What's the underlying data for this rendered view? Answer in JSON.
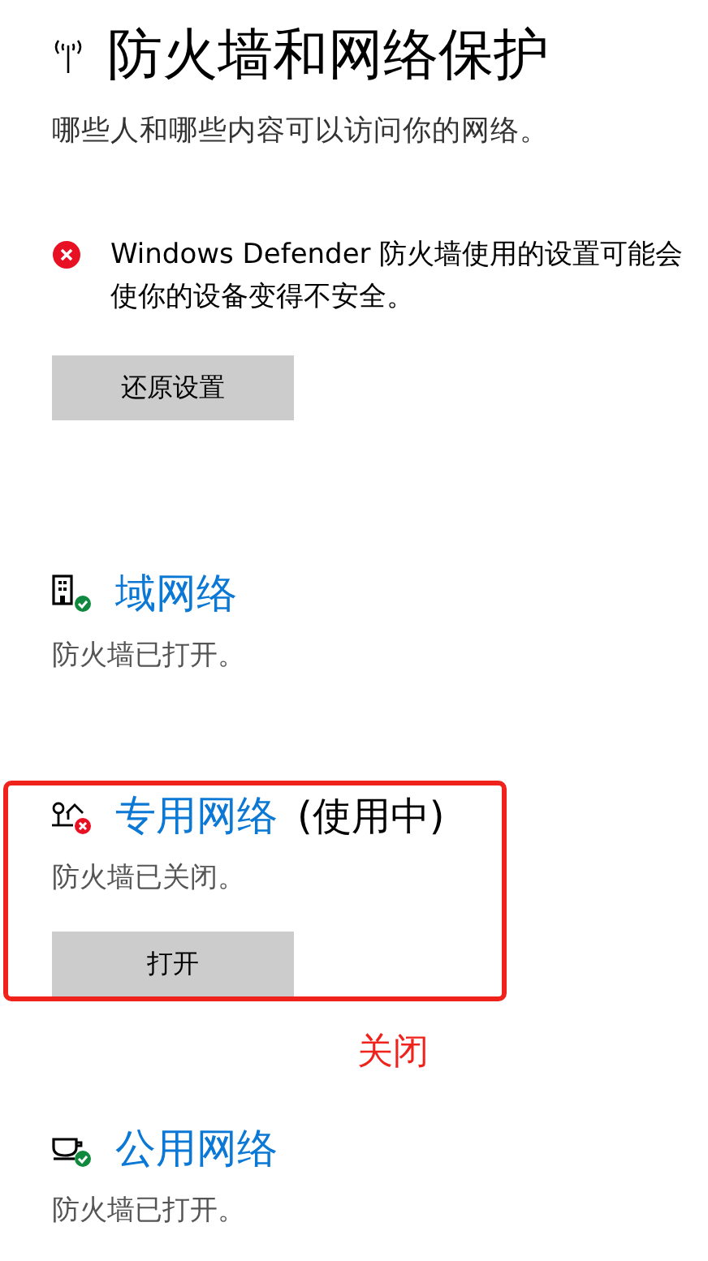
{
  "header": {
    "title": "防火墙和网络保护",
    "subtitle": "哪些人和哪些内容可以访问你的网络。"
  },
  "warning": {
    "message": "Windows Defender 防火墙使用的设置可能会使你的设备变得不安全。",
    "button": "还原设置"
  },
  "networks": [
    {
      "kind": "domain",
      "name": "域网络",
      "firewall_on": true,
      "status": "防火墙已打开。",
      "highlighted": false
    },
    {
      "kind": "private",
      "name": "专用网络",
      "in_use": "(使用中)",
      "firewall_on": false,
      "status": "防火墙已关闭。",
      "button": "打开",
      "highlighted": true,
      "annotation": "关闭"
    },
    {
      "kind": "public",
      "name": "公用网络",
      "firewall_on": true,
      "status": "防火墙已打开。",
      "highlighted": false
    }
  ]
}
